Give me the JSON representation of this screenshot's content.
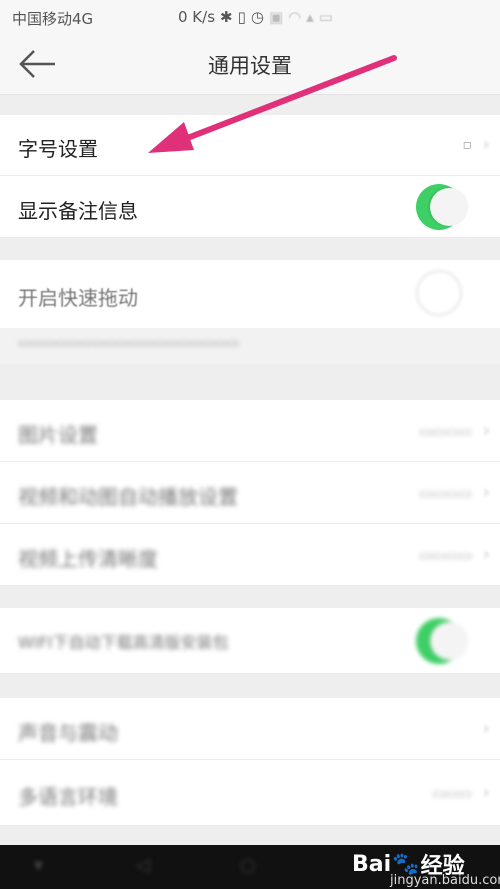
{
  "status_bar": {
    "carrier": "中国移动4G",
    "speed": "0 K/s"
  },
  "app_bar": {
    "title": "通用设置"
  },
  "settings": {
    "font_size": {
      "label": "字号设置"
    },
    "show_remark": {
      "label": "显示备注信息",
      "enabled": true
    },
    "quick_drag": {
      "label": "开启快速拖动",
      "enabled": false
    },
    "blurred_rows": [
      {
        "label": "图片设置"
      },
      {
        "label": "视频和动图自动播放设置"
      },
      {
        "label": "视频上传清晰度"
      },
      {
        "label": "WIFI下自动下载高清版安装包",
        "enabled": true
      },
      {
        "label": "声音与震动"
      },
      {
        "label": "多语言环境"
      }
    ]
  },
  "watermark": {
    "brand_a": "Bai",
    "brand_b": "经验",
    "url": "jingyan.baidu.com"
  },
  "colors": {
    "toggle_on": "#3ecf66",
    "arrow": "#e0307a"
  }
}
